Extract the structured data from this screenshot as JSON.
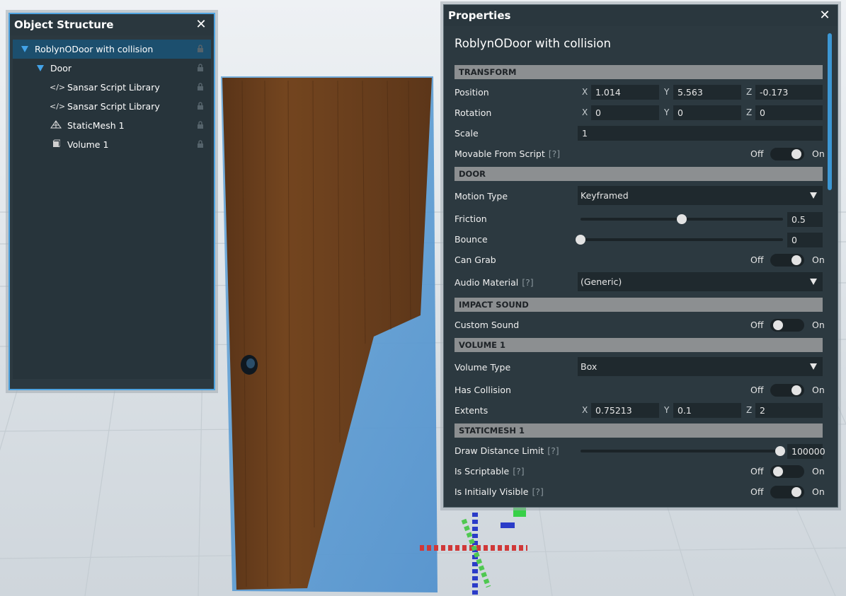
{
  "object_structure": {
    "title": "Object Structure",
    "items": [
      {
        "label": "RoblynODoor with collision",
        "icon": "expand-triangle-icon"
      },
      {
        "label": "Door",
        "icon": "expand-triangle-icon"
      },
      {
        "label": "Sansar Script Library",
        "icon": "code-icon"
      },
      {
        "label": "Sansar Script Library",
        "icon": "code-icon"
      },
      {
        "label": "StaticMesh 1",
        "icon": "mesh-icon"
      },
      {
        "label": "Volume 1",
        "icon": "volume-icon"
      }
    ]
  },
  "properties": {
    "title": "Properties",
    "object_name": "RoblynODoor with collision",
    "toggle_off": "Off",
    "toggle_on": "On",
    "help": "[?]",
    "axis": {
      "x": "X",
      "y": "Y",
      "z": "Z"
    },
    "transform": {
      "header": "TRANSFORM",
      "position_label": "Position",
      "position": {
        "x": "1.014",
        "y": "5.563",
        "z": "-0.173"
      },
      "rotation_label": "Rotation",
      "rotation": {
        "x": "0",
        "y": "0",
        "z": "0"
      },
      "scale_label": "Scale",
      "scale": "1",
      "movable_label": "Movable From Script",
      "movable_on": true
    },
    "door": {
      "header": "DOOR",
      "motion_type_label": "Motion Type",
      "motion_type": "Keyframed",
      "friction_label": "Friction",
      "friction": "0.5",
      "friction_fraction": 0.5,
      "bounce_label": "Bounce",
      "bounce": "0",
      "bounce_fraction": 0,
      "can_grab_label": "Can Grab",
      "can_grab_on": true,
      "audio_material_label": "Audio Material",
      "audio_material": "(Generic)"
    },
    "impact_sound": {
      "header": "IMPACT SOUND",
      "custom_sound_label": "Custom Sound",
      "custom_sound_on": false
    },
    "volume": {
      "header": "VOLUME 1",
      "volume_type_label": "Volume Type",
      "volume_type": "Box",
      "has_collision_label": "Has Collision",
      "has_collision_on": true,
      "extents_label": "Extents",
      "extents": {
        "x": "0.75213",
        "y": "0.1",
        "z": "2"
      }
    },
    "staticmesh": {
      "header": "STATICMESH 1",
      "draw_distance_label": "Draw Distance Limit",
      "draw_distance": "100000",
      "draw_distance_fraction": 1,
      "scriptable_label": "Is Scriptable",
      "scriptable_on": false,
      "visible_label": "Is Initially Visible",
      "visible_on": true
    }
  }
}
